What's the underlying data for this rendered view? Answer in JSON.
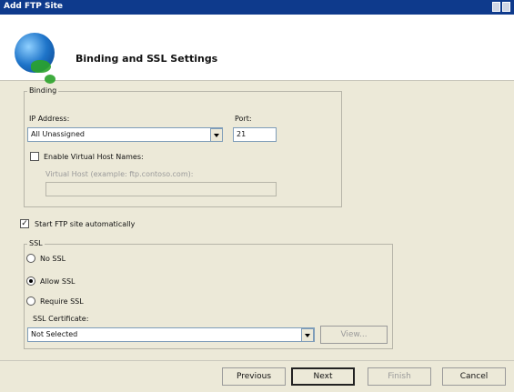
{
  "window": {
    "title": "Add FTP Site"
  },
  "header": {
    "title": "Binding and SSL Settings"
  },
  "binding": {
    "group_label": "Binding",
    "ip_label": "IP Address:",
    "ip_value": "All Unassigned",
    "port_label": "Port:",
    "port_value": "21",
    "virtual_host_checkbox_label": "Enable Virtual Host Names:",
    "virtual_host_field_label": "Virtual Host (example: ftp.contoso.com):",
    "virtual_host_value": ""
  },
  "start_automatically": {
    "label": "Start FTP site automatically",
    "checked": true
  },
  "ssl": {
    "group_label": "SSL",
    "options": [
      "No SSL",
      "Allow SSL",
      "Require SSL"
    ],
    "selected": "Allow SSL",
    "cert_label": "SSL Certificate:",
    "cert_value": "Not Selected",
    "view_label": "View..."
  },
  "footer": {
    "previous": "Previous",
    "next": "Next",
    "finish": "Finish",
    "cancel": "Cancel"
  },
  "icons": {
    "header_icon": "globe-icon"
  },
  "colors": {
    "titlebar": "#0e3a8c",
    "dialog_bg": "#ece9d8",
    "header_bg": "#ffffff"
  }
}
